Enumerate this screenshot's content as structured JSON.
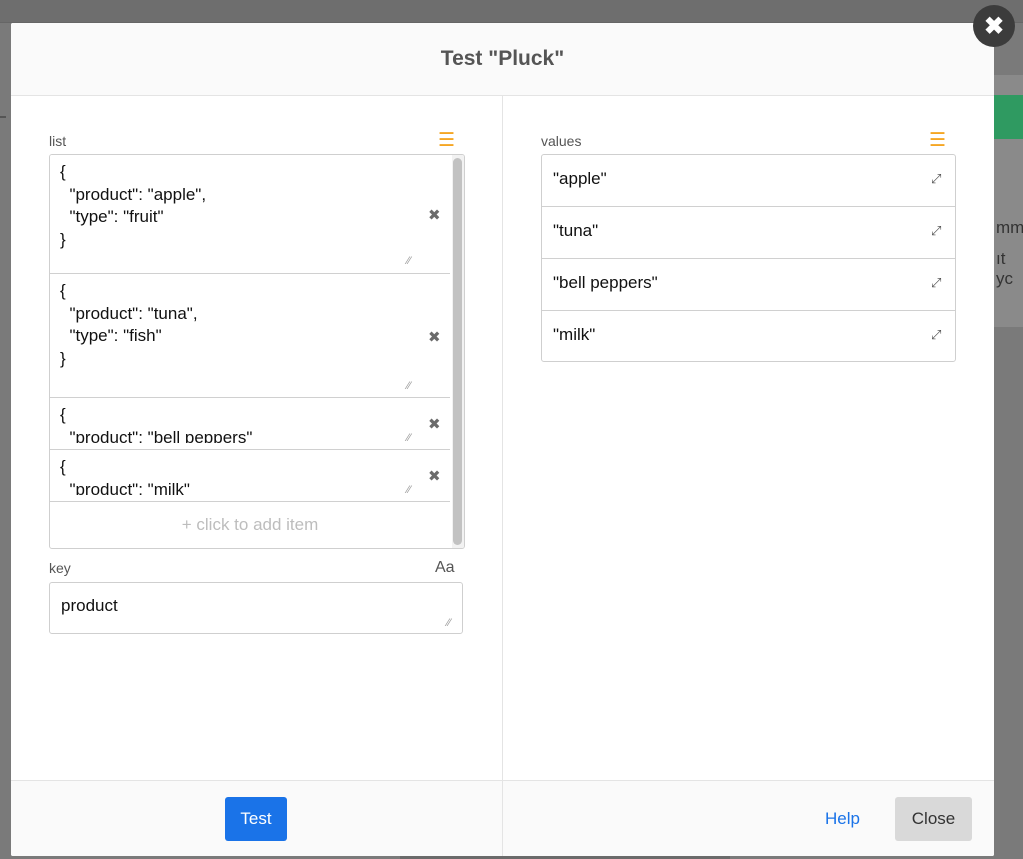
{
  "modal": {
    "title": "Test \"Pluck\"",
    "close_glyph": "✖"
  },
  "left": {
    "list_label": "list",
    "list_icon": "list-icon",
    "items": [
      {
        "text": "{\n  \"product\": \"apple\",\n  \"type\": \"fruit\"\n}"
      },
      {
        "text": "{\n  \"product\": \"tuna\",\n  \"type\": \"fish\"\n}"
      },
      {
        "text": "{\n  \"product\": \"bell peppers\""
      },
      {
        "text": "{\n  \"product\": \"milk\""
      }
    ],
    "add_item_label": "+ click to add item",
    "key_label": "key",
    "key_type_label": "Aa",
    "key_value": "product"
  },
  "right": {
    "values_label": "values",
    "values_icon": "list-icon",
    "values": [
      "\"apple\"",
      "\"tuna\"",
      "\"bell peppers\"",
      "\"milk\""
    ]
  },
  "footer": {
    "test_label": "Test",
    "help_label": "Help",
    "close_label": "Close"
  },
  "background": {
    "text_line_1": "mm",
    "text_line_2": "ıt yc"
  },
  "colors": {
    "accent": "#1a73e8",
    "icon_orange": "#f5a623",
    "overlay": "#7a7a7a"
  }
}
